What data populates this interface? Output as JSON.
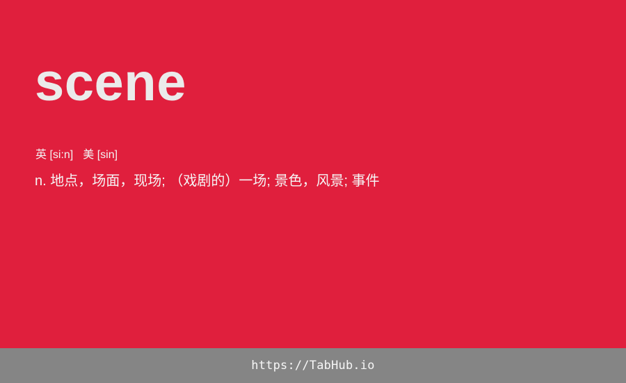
{
  "card": {
    "background": "#e01f3d",
    "word": "scene",
    "phonetics": {
      "uk": "英 [si:n]",
      "us": "美 [sin]"
    },
    "definition": "n. 地点，场面，现场; （戏剧的）一场; 景色，风景; 事件"
  },
  "footer": {
    "background": "#858585",
    "link_text": "https://TabHub.io"
  }
}
